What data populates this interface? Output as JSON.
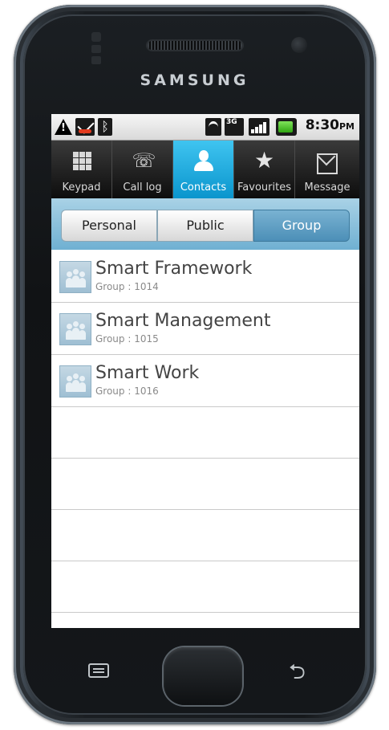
{
  "device": {
    "brand": "SAMSUNG"
  },
  "statusbar": {
    "time": "8:30",
    "time_suffix": "PM",
    "network_label": "3G",
    "icons": [
      "warning-icon",
      "missed-call-icon",
      "bluetooth-icon",
      "wifi-icon",
      "3g-icon",
      "signal-icon",
      "battery-icon"
    ]
  },
  "tabs": [
    {
      "label": "Keypad",
      "icon": "keypad-icon",
      "active": false
    },
    {
      "label": "Call log",
      "icon": "call-log-icon",
      "active": false
    },
    {
      "label": "Contacts",
      "icon": "contacts-icon",
      "active": true
    },
    {
      "label": "Favourites",
      "icon": "star-icon",
      "active": false
    },
    {
      "label": "Message",
      "icon": "envelope-icon",
      "active": false
    }
  ],
  "segments": [
    {
      "label": "Personal",
      "selected": false
    },
    {
      "label": "Public",
      "selected": false
    },
    {
      "label": "Group",
      "selected": true
    }
  ],
  "groups": [
    {
      "name": "Smart Framework",
      "sub": "Group : 1014"
    },
    {
      "name": "Smart Management",
      "sub": "Group : 1015"
    },
    {
      "name": "Smart Work",
      "sub": "Group : 1016"
    }
  ],
  "colors": {
    "accent": "#1aa6dc",
    "segment_selected": "#5e9ec4"
  }
}
